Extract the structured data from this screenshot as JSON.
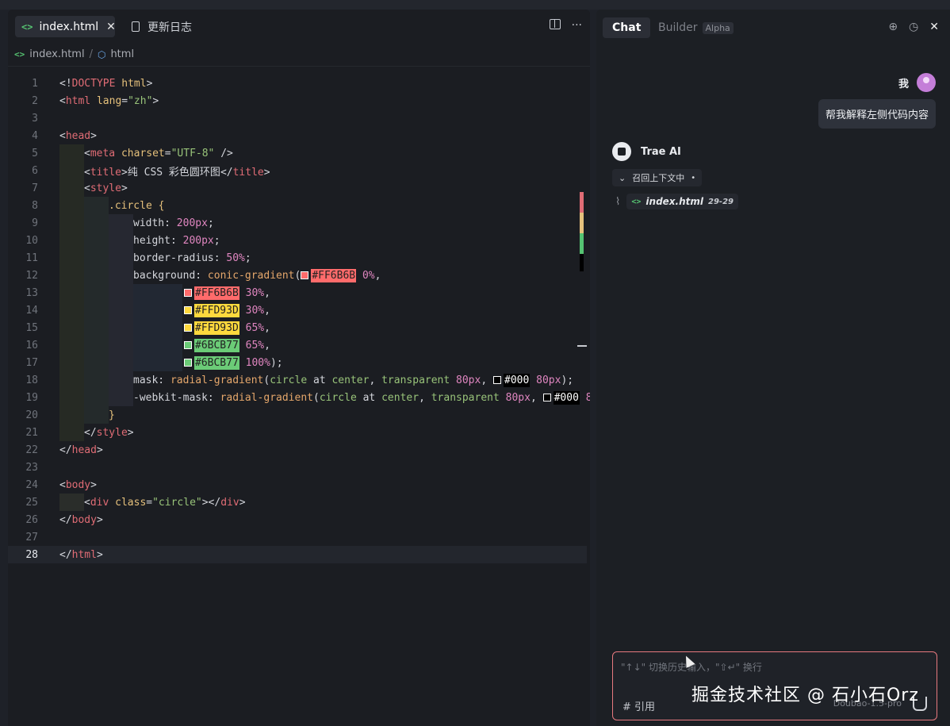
{
  "editor": {
    "tabs": [
      {
        "label": "index.html",
        "active": true
      },
      {
        "label": "更新日志",
        "active": false
      }
    ],
    "breadcrumb": [
      "index.html",
      "html"
    ],
    "current_line": 28
  },
  "chat": {
    "tabs": {
      "chat": "Chat",
      "builder": "Builder",
      "builder_badge": "Alpha"
    },
    "user_name": "我",
    "user_message": "帮我解释左侧代码内容",
    "ai_name": "Trae AI",
    "recall_label": "召回上下文中",
    "ref_file": "index.html",
    "ref_range": "29-29",
    "input_placeholder": "\"↑↓\" 切换历史输入，\"⇧↵\" 换行",
    "cite_label": "# 引用",
    "model_label": "Doubao-1.5-pro",
    "watermark": "掘金技术社区 @ 石小石Orz"
  },
  "colors": {
    "red": "#FF6B6B",
    "yellow": "#FFD93D",
    "green": "#6BCB77",
    "black": "#000"
  }
}
